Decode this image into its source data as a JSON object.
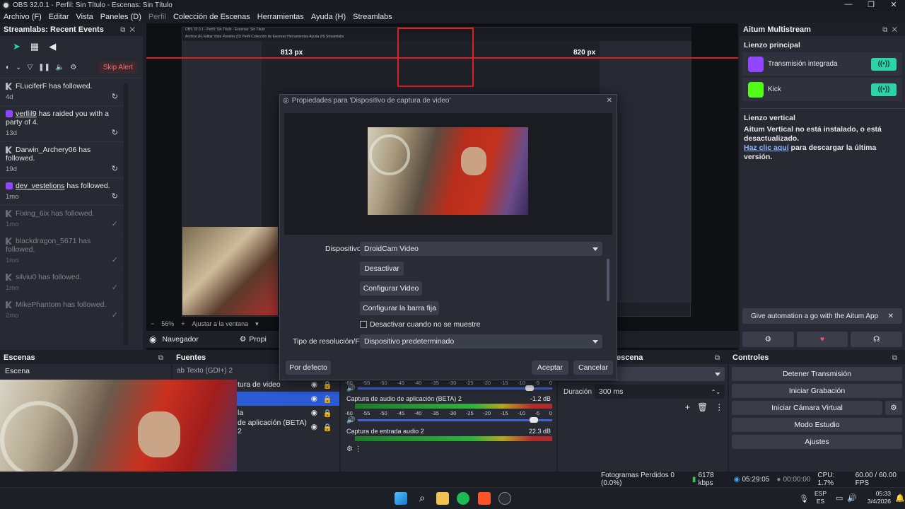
{
  "window": {
    "title": "OBS 32.0.1 - Perfil: Sin Título - Escenas: Sin Título",
    "controls": [
      "—",
      "❐",
      "✕"
    ]
  },
  "menu": {
    "items": [
      "Archivo (F)",
      "Editar",
      "Vista",
      "Paneles (D)",
      "Perfil",
      "Colección de Escenas",
      "Herramientas",
      "Ayuda (H)",
      "Streamlabs"
    ]
  },
  "events": {
    "title": "Streamlabs: Recent Events",
    "skip_alert": "Skip Alert",
    "items": [
      {
        "icon": "kick",
        "name": "FLuciferF",
        "text": " has followed.",
        "time": "4d",
        "action": "↻",
        "dim": false
      },
      {
        "icon": "twitch",
        "name": "verllil9",
        "text": " has raided you with a party of 4.",
        "time": "13d",
        "action": "↻",
        "dim": false
      },
      {
        "icon": "kick",
        "name": "Darwin_Archery06",
        "text": " has followed.",
        "time": "19d",
        "action": "↻",
        "dim": false
      },
      {
        "icon": "twitch",
        "name": "dev_vestelions",
        "text": " has followed.",
        "time": "1mo",
        "action": "↻",
        "dim": false
      },
      {
        "icon": "kick",
        "name": "Fixing_6ix",
        "text": " has followed.",
        "time": "1mo",
        "action": "✓",
        "dim": true
      },
      {
        "icon": "kick",
        "name": "blackdragon_5671",
        "text": " has followed.",
        "time": "1mo",
        "action": "✓",
        "dim": true
      },
      {
        "icon": "kick",
        "name": "silviu0",
        "text": " has followed.",
        "time": "1mo",
        "action": "✓",
        "dim": true
      },
      {
        "icon": "kick",
        "name": "MikePhantom",
        "text": " has followed.",
        "time": "2mo",
        "action": "✓",
        "dim": true
      }
    ]
  },
  "preview": {
    "px_left": "813 px",
    "px_right": "820 px",
    "zoom": "56%",
    "fit": "Ajustar a la ventana"
  },
  "nav": {
    "navegador": "Navegador",
    "propiedades": "Propi"
  },
  "dialog": {
    "title": "Propiedades para 'Dispositivo de captura de video'",
    "device_label": "Dispositivo",
    "device_value": "DroidCam Video",
    "btn_deactivate": "Desactivar",
    "btn_config_video": "Configurar Video",
    "btn_config_bar": "Configurar la barra fija",
    "checkbox_label": "Desactivar cuando no se muestre",
    "res_label": "Tipo de resolución/FPS",
    "res_value": "Dispositivo predeterminado",
    "btn_default": "Por defecto",
    "btn_accept": "Aceptar",
    "btn_cancel": "Cancelar"
  },
  "aitum": {
    "title": "Aitum Multistream",
    "main_canvas": "Lienzo principal",
    "outputs": [
      {
        "name": "Transmisión integrada",
        "icon": "twitch"
      },
      {
        "name": "Kick",
        "icon": "kick"
      }
    ],
    "vertical_title": "Lienzo vertical",
    "vertical_msg": "Aitum Vertical no está instalado, o está desactualizado.",
    "vertical_link": "Haz clic aquí",
    "vertical_tail": " para descargar la última versión.",
    "automation": "Give automation a go with the Aitum App"
  },
  "scenes": {
    "title": "Escenas",
    "items": [
      "Escena"
    ]
  },
  "sources": {
    "title": "Fuentes",
    "items": [
      "Texto (GDI+) 2",
      "tura de video",
      "",
      "la",
      "de aplicación (BETA) 2"
    ]
  },
  "mixer": {
    "scale": [
      "-60",
      "-55",
      "-50",
      "-45",
      "-40",
      "-35",
      "-30",
      "-25",
      "-20",
      "-15",
      "-10",
      "-5",
      "0"
    ],
    "channels": [
      {
        "name": "Captura de audio de aplicación (BETA) 2",
        "db": "-1.2 dB"
      },
      {
        "name": "Captura de entrada audio 2",
        "db": "22.3 dB"
      }
    ]
  },
  "transitions": {
    "title": "escena",
    "duration_label": "Duración",
    "duration_value": "300 ms"
  },
  "controls": {
    "title": "Controles",
    "buttons": [
      "Detener Transmisión",
      "Iniciar Grabación",
      "Iniciar Cámara Virtual",
      "Modo Estudio",
      "Ajustes"
    ]
  },
  "status": {
    "dropped": "Fotogramas Perdidos 0 (0.0%)",
    "kbps": "6178 kbps",
    "stream_time": "05:29:05",
    "rec_time": "00:00:00",
    "cpu": "CPU: 1.7%",
    "fps": "60.00 / 60.00 FPS"
  },
  "taskbar": {
    "lang": "ESP",
    "lang2": "ES",
    "time": "05:33",
    "date": "3/4/2026"
  },
  "colors": {
    "accent": "#2dd4a7",
    "twitch": "#9146ff",
    "kick": "#53fc18",
    "skip": "#ff6b6b"
  }
}
